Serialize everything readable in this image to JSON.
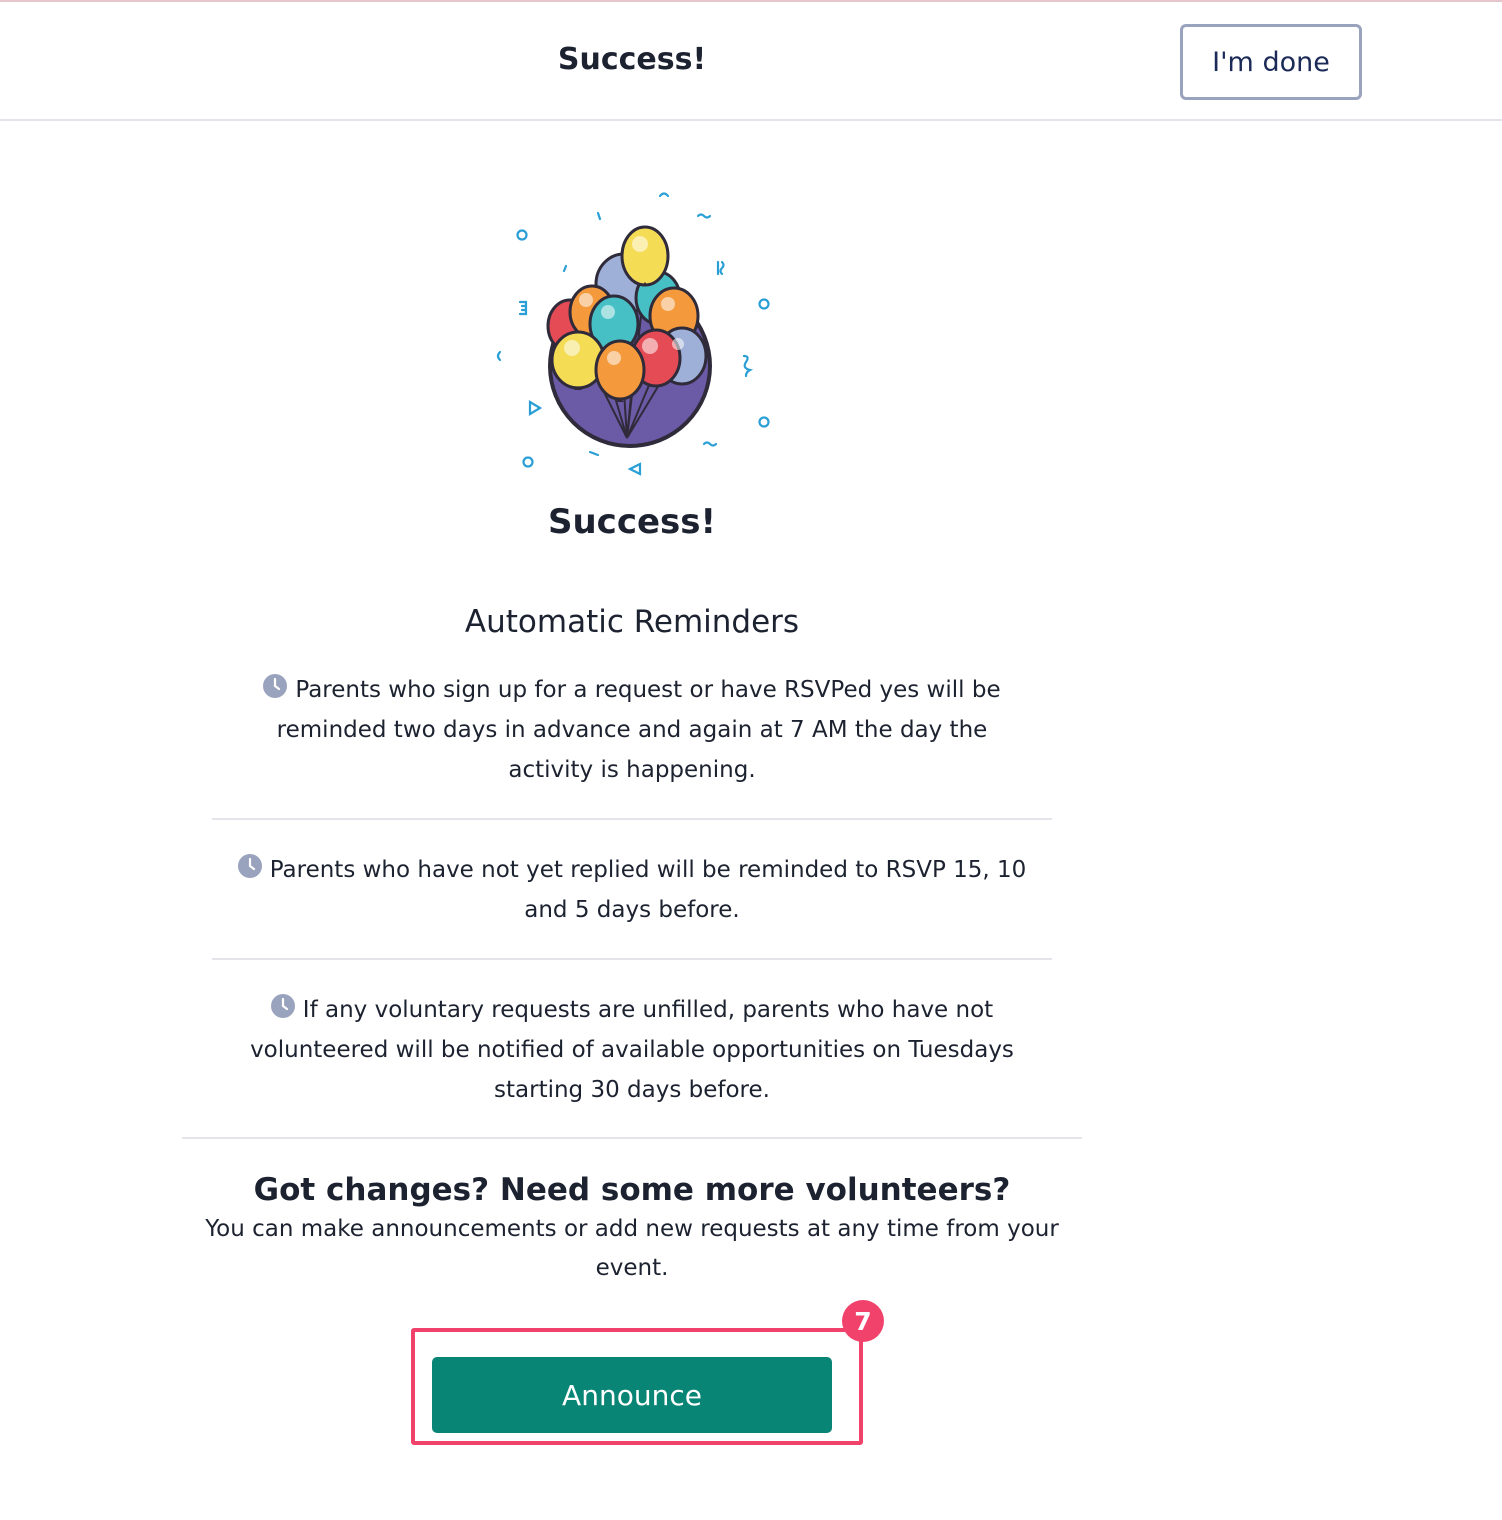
{
  "header": {
    "title": "Success!",
    "done_label": "I'm done"
  },
  "hero": {
    "illustration_icon": "balloons-icon",
    "title": "Success!"
  },
  "reminders": {
    "title": "Automatic Reminders",
    "icon": "clock-icon",
    "items": [
      {
        "text": "Parents who sign up for a request or have RSVPed yes will be reminded two days in advance and again at 7 AM the day the activity is happening."
      },
      {
        "text": "Parents who have not yet replied will be reminded to RSVP 15, 10 and 5 days before."
      },
      {
        "text": "If any voluntary requests are unfilled, parents who have not volunteered will be notified of available opportunities on Tuesdays starting 30 days before."
      }
    ]
  },
  "cta": {
    "title": "Got changes? Need some more volunteers?",
    "body": "You can make announcements or add new requests at any time from your event.",
    "button_label": "Announce",
    "step_badge": "7"
  },
  "colors": {
    "accent_teal": "#088575",
    "highlight_pink": "#f1426c",
    "done_border": "#9aa3bd",
    "clock_gray": "#9aa3bd"
  }
}
